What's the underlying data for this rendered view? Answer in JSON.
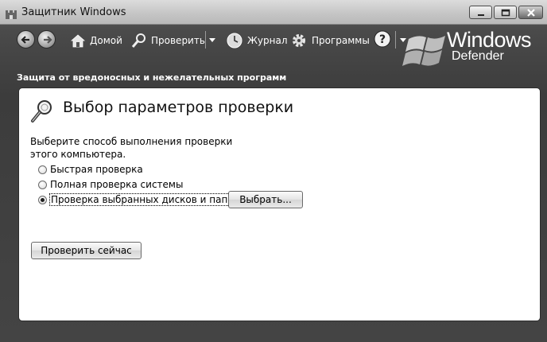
{
  "window": {
    "title": "Защитник Windows",
    "app_icon": "defender-castle-icon"
  },
  "caption_buttons": {
    "minimize": "minimize-icon",
    "maximize": "maximize-icon",
    "close": "close-icon"
  },
  "toolbar": {
    "back_icon": "back-arrow-icon",
    "forward_icon": "forward-arrow-icon",
    "home_label": "Домой",
    "scan_label": "Проверить",
    "history_label": "Журнал",
    "tools_label": "Программы",
    "help_icon": "help-icon"
  },
  "logo": {
    "line1": "Windows",
    "line2": "Defender"
  },
  "subtitle": "Защита от вредоносных и нежелательных программ",
  "panel": {
    "title": "Выбор параметров проверки",
    "description": "Выберите способ выполнения проверки этого компьютера.",
    "options": [
      {
        "label": "Быстрая проверка",
        "checked": false
      },
      {
        "label": "Полная проверка системы",
        "checked": false
      },
      {
        "label": "Проверка выбранных дисков и папок",
        "checked": true
      }
    ],
    "choose_button": "Выбрать...",
    "scan_now_button": "Проверить сейчас"
  }
}
